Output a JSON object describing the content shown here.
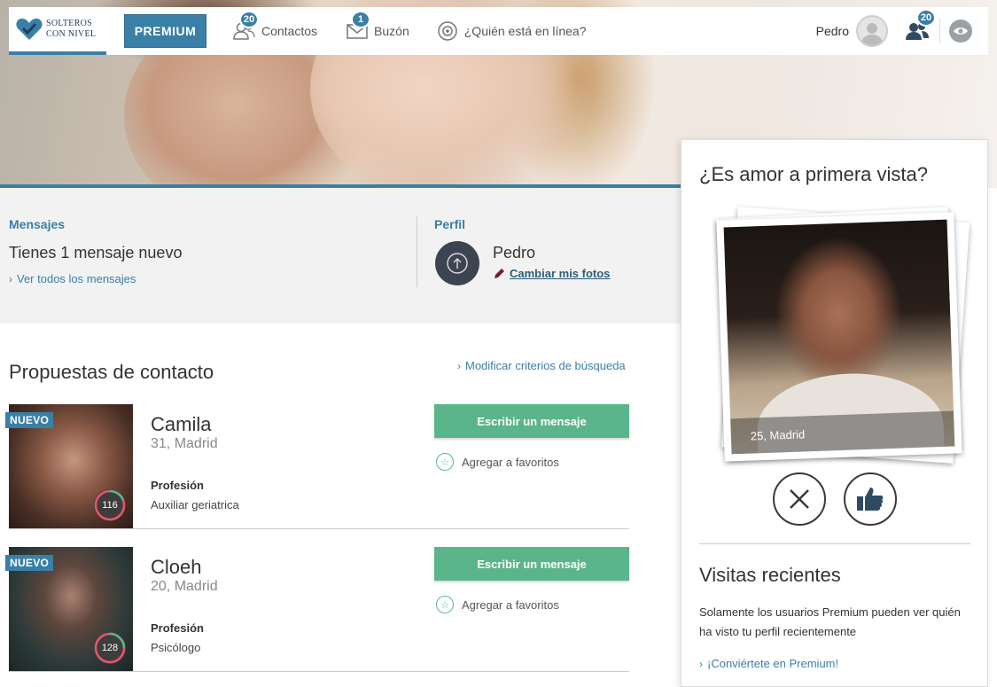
{
  "nav": {
    "logo_line1": "SOLTEROS",
    "logo_line2": "CON NIVEL",
    "premium_label": "PREMIUM",
    "contacts_label": "Contactos",
    "contacts_badge": "20",
    "inbox_label": "Buzón",
    "inbox_badge": "1",
    "online_label": "¿Quién está en línea?",
    "user_name": "Pedro",
    "visitors_badge": "20"
  },
  "messages": {
    "title": "Mensajes",
    "text": "Tienes 1 mensaje nuevo",
    "link": "Ver todos los mensajes"
  },
  "profile": {
    "title": "Perfil",
    "name": "Pedro",
    "link": "Cambiar mis fotos"
  },
  "proposals": {
    "title": "Propuestas de contacto",
    "modify_link": "Modificar criterios de búsqueda",
    "items": [
      {
        "badge": "NUEVO",
        "name": "Camila",
        "agecity": "31, Madrid",
        "prof_label": "Profesión",
        "profession": "Auxiliar geriatrica",
        "score": "116",
        "write_label": "Escribir un mensaje",
        "fav_label": "Agregar a favoritos"
      },
      {
        "badge": "NUEVO",
        "name": "Cloeh",
        "agecity": "20, Madrid",
        "prof_label": "Profesión",
        "profession": "Psicólogo",
        "score": "128",
        "write_label": "Escribir un mensaje",
        "fav_label": "Agregar a favoritos"
      }
    ]
  },
  "love": {
    "title": "¿Es amor a primera vista?",
    "caption": "25, Madrid"
  },
  "visits": {
    "title": "Visitas recientes",
    "text": "Solamente los usuarios Premium pueden ver quién ha visto tu perfil recientemente",
    "link": "¡Conviértete en Premium!"
  },
  "colors": {
    "accent": "#3a7fa6",
    "green": "#5ab58a"
  }
}
